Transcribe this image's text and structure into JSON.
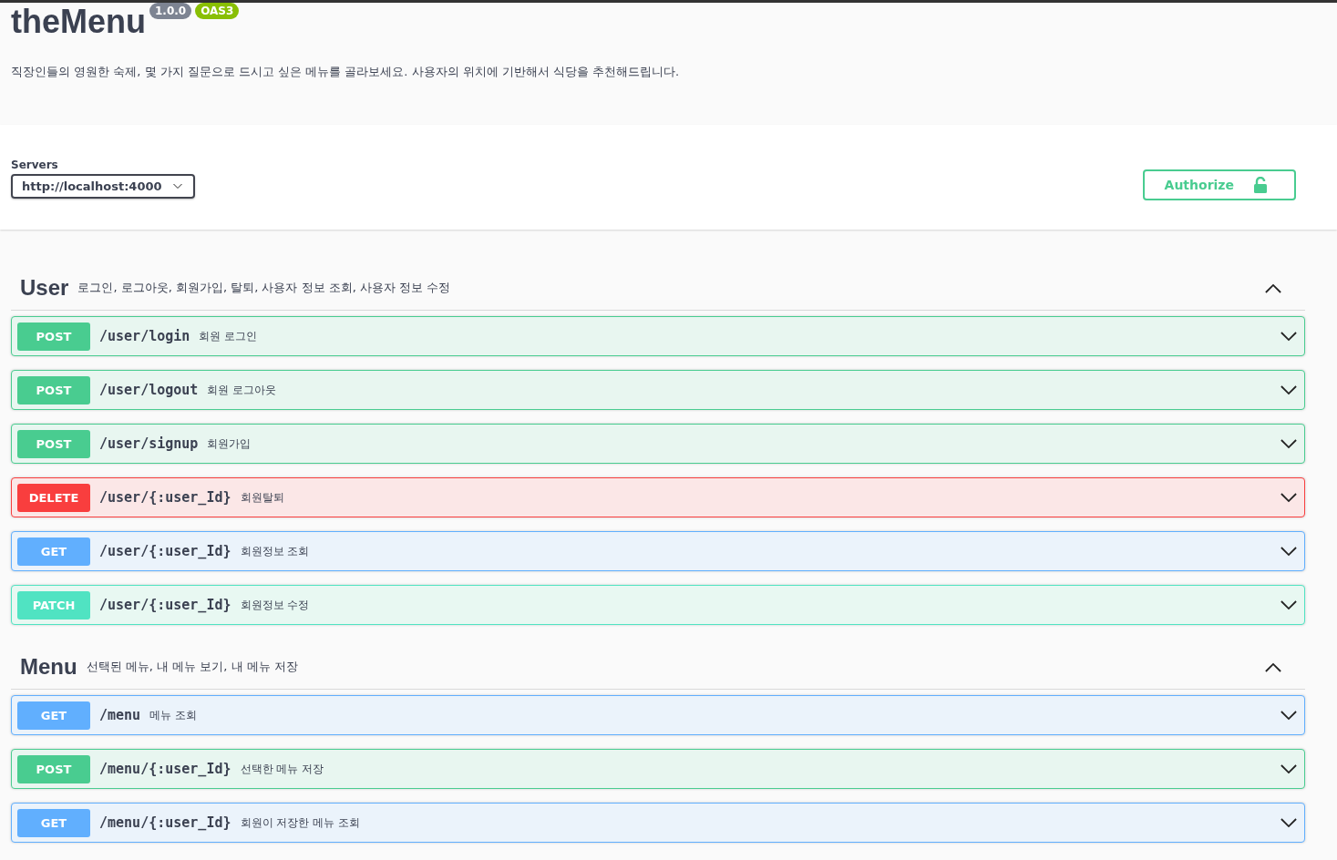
{
  "info": {
    "title": "theMenu",
    "version": "1.0.0",
    "spec": "OAS3",
    "description": "직장인들의 영원한 숙제, 몇 가지 질문으로 드시고 싶은 메뉴를 골라보세요. 사용자의 위치에 기반해서 식당을 추천해드립니다."
  },
  "servers": {
    "label": "Servers",
    "value": "http://localhost:4000"
  },
  "authorize": {
    "label": "Authorize",
    "locked": false
  },
  "sections": [
    {
      "name": "User",
      "description": "로그인, 로그아웃, 회원가입, 탈퇴, 사용자 정보 조회, 사용자 정보 수정",
      "expanded": true,
      "operations": [
        {
          "kind": "post",
          "method": "POST",
          "path": "/user/login",
          "summary": "회원 로그인",
          "expanded": false
        },
        {
          "kind": "post",
          "method": "POST",
          "path": "/user/logout",
          "summary": "회원 로그아웃",
          "expanded": false
        },
        {
          "kind": "post",
          "method": "POST",
          "path": "/user/signup",
          "summary": "회원가입",
          "expanded": false
        },
        {
          "kind": "delete",
          "method": "DELETE",
          "path": "/user/{:user_Id}",
          "summary": "회원탈퇴",
          "expanded": false
        },
        {
          "kind": "get",
          "method": "GET",
          "path": "/user/{:user_Id}",
          "summary": "회원정보 조회",
          "expanded": false
        },
        {
          "kind": "patch",
          "method": "PATCH",
          "path": "/user/{:user_Id}",
          "summary": "회원정보 수정",
          "expanded": false
        }
      ]
    },
    {
      "name": "Menu",
      "description": "선택된 메뉴, 내 메뉴 보기, 내 메뉴 저장",
      "expanded": true,
      "operations": [
        {
          "kind": "get",
          "method": "GET",
          "path": "/menu",
          "summary": "메뉴 조회",
          "expanded": false
        },
        {
          "kind": "post",
          "method": "POST",
          "path": "/menu/{:user_Id}",
          "summary": "선택한 메뉴 저장",
          "expanded": false
        },
        {
          "kind": "get",
          "method": "GET",
          "path": "/menu/{:user_Id}",
          "summary": "회원이 저장한 메뉴 조회",
          "expanded": false
        }
      ]
    }
  ]
}
